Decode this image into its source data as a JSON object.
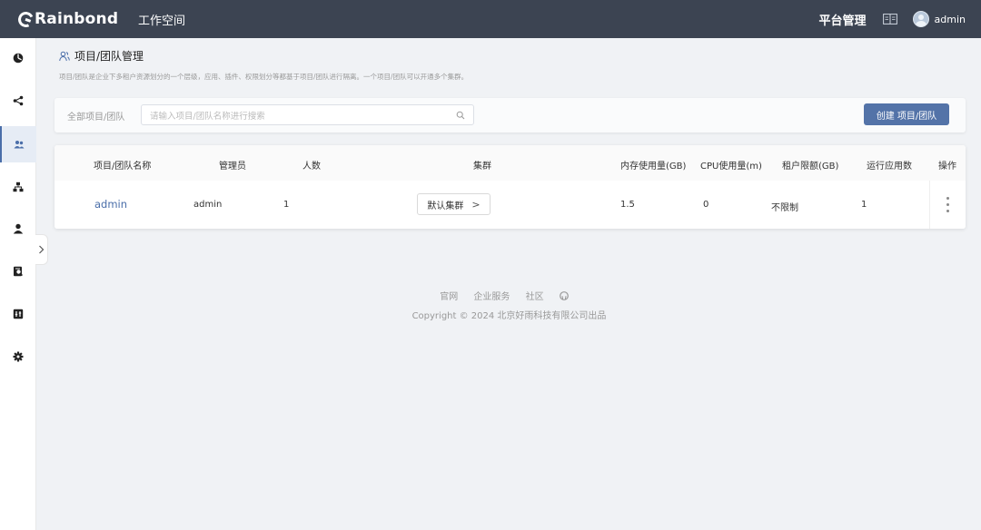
{
  "header": {
    "brand": "Rainbond",
    "workspace_label": "工作空间",
    "platform_label": "平台管理",
    "username": "admin"
  },
  "sidebar": {
    "items": [
      {
        "icon": "dashboard-icon"
      },
      {
        "icon": "share-icon"
      },
      {
        "icon": "team-icon",
        "active": true
      },
      {
        "icon": "cluster-icon"
      },
      {
        "icon": "user-icon"
      },
      {
        "icon": "audit-icon"
      },
      {
        "icon": "monitor-icon"
      },
      {
        "icon": "settings-icon"
      }
    ]
  },
  "page": {
    "title": "项目/团队管理",
    "description": "项目/团队是企业下多租户资源划分的一个层级，应用、插件、权限划分等都基于项目/团队进行隔离。一个项目/团队可以开通多个集群。"
  },
  "search": {
    "label": "全部项目/团队",
    "placeholder": "请输入项目/团队名称进行搜索",
    "value": "",
    "create_label": "创建 项目/团队"
  },
  "table": {
    "columns": [
      "项目/团队名称",
      "管理员",
      "人数",
      "集群",
      "内存使用量(GB)",
      "CPU使用量(m)",
      "租户限额(GB)",
      "运行应用数",
      "操作"
    ],
    "rows": [
      {
        "name": "admin",
        "admin": "admin",
        "members": "1",
        "cluster": "默认集群",
        "memory": "1.5",
        "cpu": "0",
        "quota": "不限制",
        "running_apps": "1"
      }
    ]
  },
  "footer": {
    "links": [
      "官网",
      "企业服务",
      "社区"
    ],
    "copyright": "Copyright © 2024 北京好雨科技有限公司出品"
  }
}
